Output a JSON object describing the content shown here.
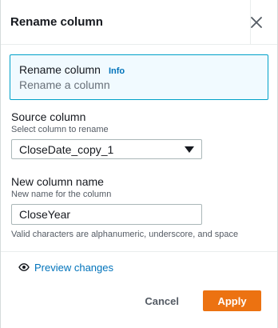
{
  "header": {
    "title": "Rename column"
  },
  "info": {
    "title": "Rename column",
    "link": "Info",
    "description": "Rename a column"
  },
  "source": {
    "label": "Source column",
    "description": "Select column to rename",
    "selected": "CloseDate_copy_1"
  },
  "new_name": {
    "label": "New column name",
    "description": "New name for the column",
    "value": "CloseYear",
    "help": "Valid characters are alphanumeric, underscore, and space"
  },
  "preview": {
    "label": "Preview changes"
  },
  "footer": {
    "cancel_label": "Cancel",
    "apply_label": "Apply"
  },
  "colors": {
    "accent": "#ec7211",
    "link": "#0073bb",
    "info_border": "#00a1c9",
    "info_bg": "#f1faff"
  }
}
